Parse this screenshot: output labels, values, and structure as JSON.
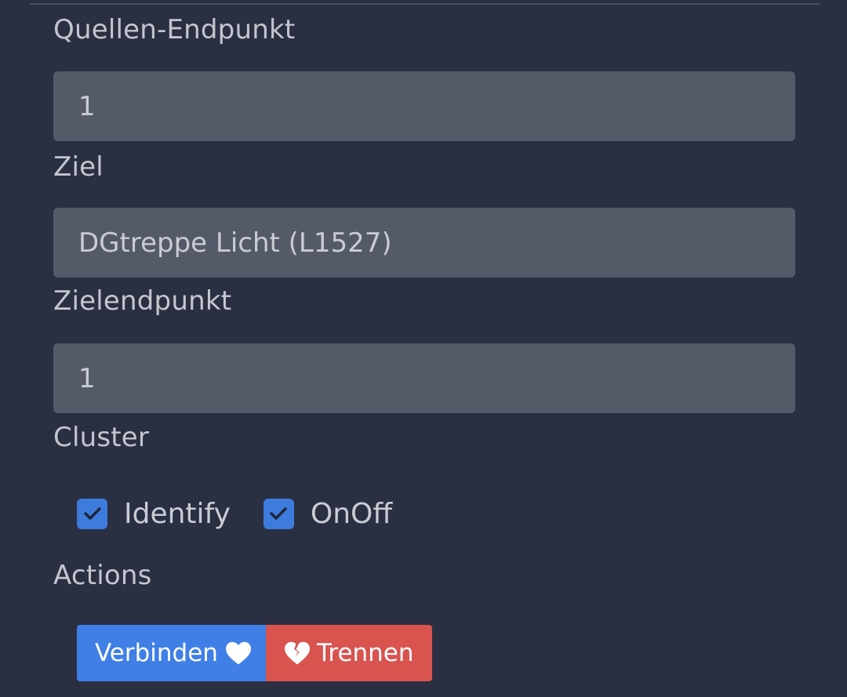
{
  "form": {
    "source_endpoint": {
      "label": "Quellen-Endpunkt",
      "value": "1"
    },
    "target": {
      "label": "Ziel",
      "value": "DGtreppe Licht (L1527)"
    },
    "target_endpoint": {
      "label": "Zielendpunkt",
      "value": "1"
    },
    "cluster": {
      "label": "Cluster",
      "options": [
        {
          "label": "Identify",
          "checked": true
        },
        {
          "label": "OnOff",
          "checked": true
        }
      ]
    },
    "actions": {
      "label": "Actions",
      "connect_label": "Verbinden",
      "disconnect_label": "Trennen"
    }
  },
  "icons": {
    "connect": "heart-icon",
    "disconnect": "broken-heart-icon",
    "checkbox": "checkmark-icon"
  },
  "colors": {
    "background": "#2a2f42",
    "input_background": "#545a68",
    "checkbox": "#3d7bdc",
    "connect_button": "#3f7fe6",
    "disconnect_button": "#d9534f"
  }
}
